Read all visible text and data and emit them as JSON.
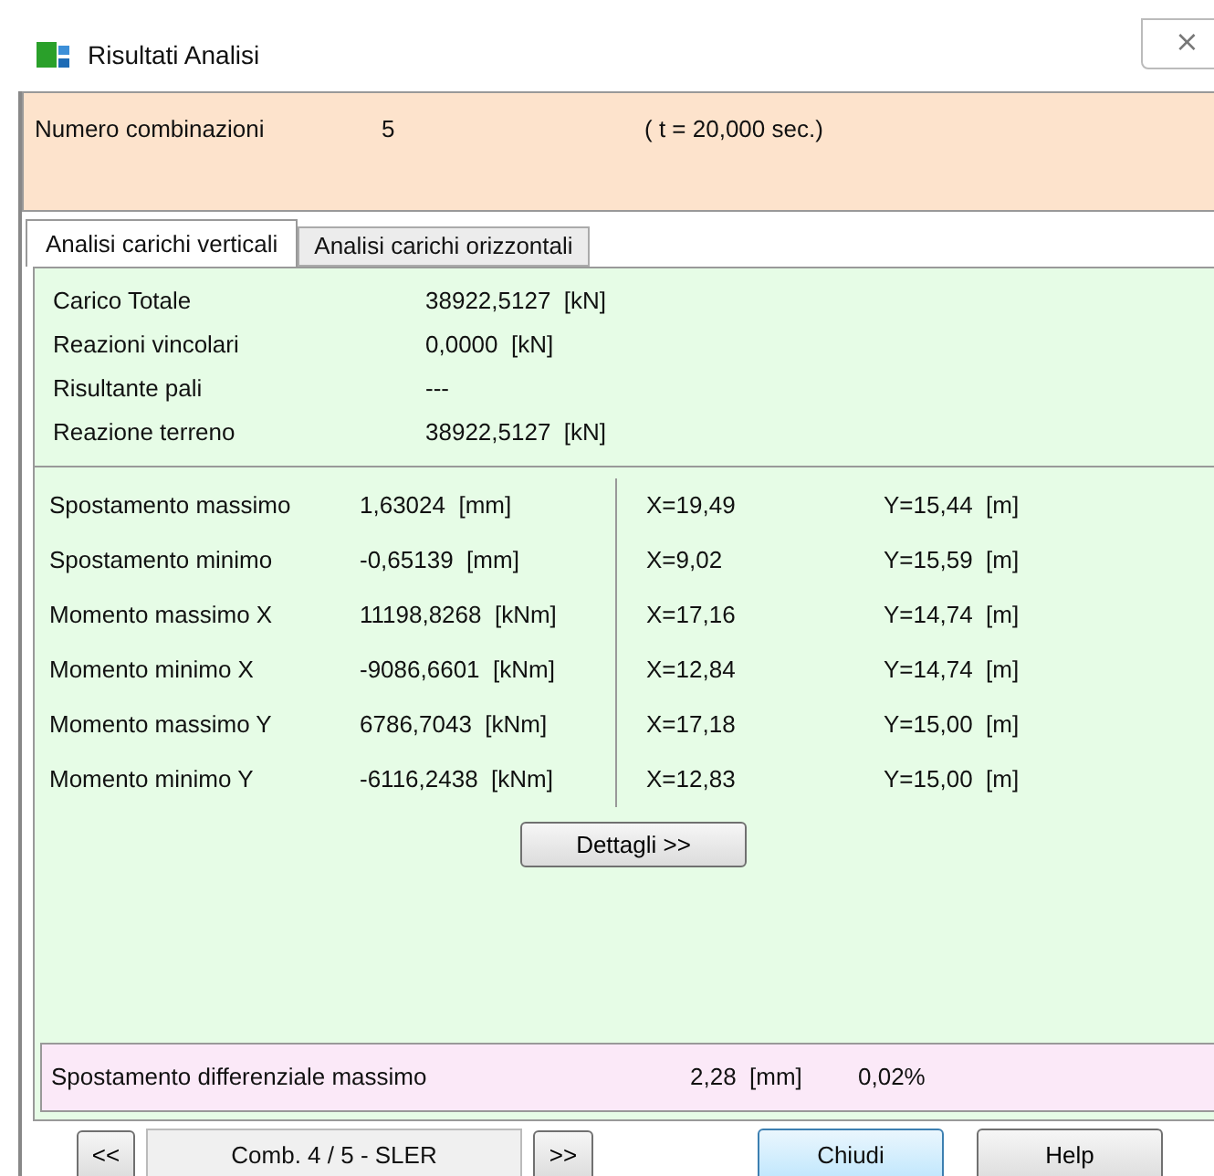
{
  "window": {
    "title": "Risultati Analisi",
    "close": "⨯"
  },
  "header": {
    "label": "Numero combinazioni",
    "value": "5",
    "time": "( t = 20,000 sec.)"
  },
  "tabs": [
    {
      "label": "Analisi carichi verticali",
      "selected": true
    },
    {
      "label": "Analisi carichi orizzontali",
      "selected": false
    }
  ],
  "totals": [
    {
      "label": "Carico Totale",
      "value": "38922,5127  [kN]"
    },
    {
      "label": "Reazioni vincolari",
      "value": "0,0000  [kN]"
    },
    {
      "label": "Risultante pali",
      "value": "---"
    },
    {
      "label": "Reazione terreno",
      "value": "38922,5127  [kN]"
    }
  ],
  "results": [
    {
      "label": "Spostamento massimo",
      "value": "1,63024  [mm]",
      "x": "X=19,49",
      "y": "Y=15,44  [m]"
    },
    {
      "label": "Spostamento minimo",
      "value": "-0,65139  [mm]",
      "x": "X=9,02",
      "y": "Y=15,59  [m]"
    },
    {
      "label": "Momento massimo X",
      "value": "11198,8268  [kNm]",
      "x": "X=17,16",
      "y": "Y=14,74  [m]"
    },
    {
      "label": "Momento minimo X",
      "value": "-9086,6601  [kNm]",
      "x": "X=12,84",
      "y": "Y=14,74  [m]"
    },
    {
      "label": "Momento massimo Y",
      "value": "6786,7043  [kNm]",
      "x": "X=17,18",
      "y": "Y=15,00  [m]"
    },
    {
      "label": "Momento minimo Y",
      "value": "-6116,2438  [kNm]",
      "x": "X=12,83",
      "y": "Y=15,00  [m]"
    }
  ],
  "details_button": "Dettagli >>",
  "differential": {
    "label": "Spostamento differenziale massimo",
    "value": "2,28  [mm]",
    "percent": "0,02%"
  },
  "footer": {
    "prev": "<<",
    "combination": "Comb. 4 / 5 - SLER",
    "next": ">>",
    "close": "Chiudi",
    "help": "Help"
  }
}
